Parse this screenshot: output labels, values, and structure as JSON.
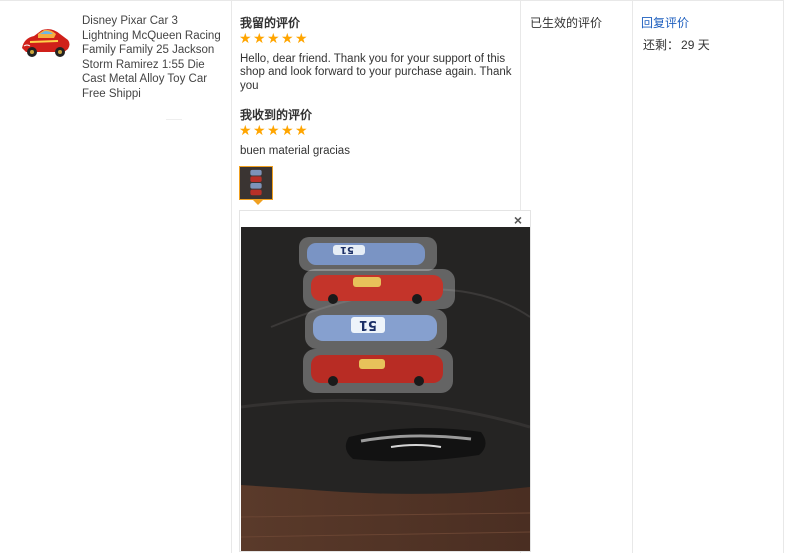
{
  "product": {
    "title": "Disney Pixar Car 3 Lightning McQueen Racing Family Family 25 Jackson Storm Ramirez 1:55 Die Cast Metal Alloy Toy Car Free Shippi",
    "thumbnail_icon": "red-race-car-icon"
  },
  "my_review": {
    "heading": "我留的评价",
    "rating": 5,
    "text": "Hello, dear friend. Thank you for your support of this shop and look forward to your purchase again. Thank you"
  },
  "received_review": {
    "heading": "我收到的评价",
    "rating": 5,
    "text": "buen material gracias",
    "photo_count": 1
  },
  "photo_popup": {
    "close_symbol": "×"
  },
  "status": {
    "text": "已生效的评价"
  },
  "actions": {
    "reply_label": "回复评价",
    "remaining_label": "还剩：",
    "remaining_value": "29 天"
  },
  "colors": {
    "star": "#ffa500",
    "link": "#1e5fbf",
    "thumb_border": "#f0a020",
    "divider": "#e8e8e8"
  }
}
